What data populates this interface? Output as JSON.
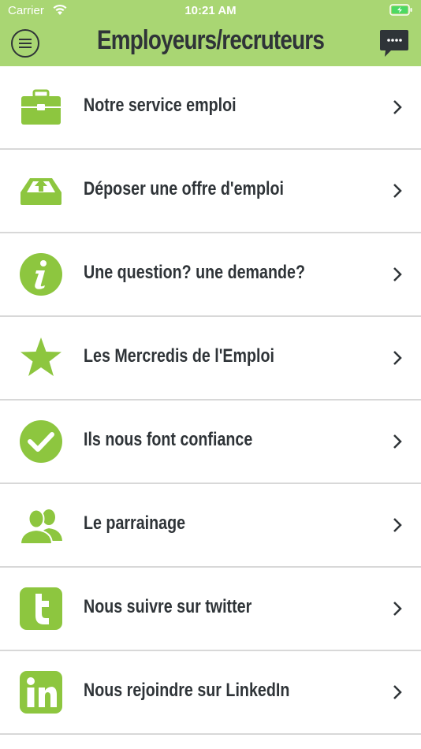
{
  "status_bar": {
    "carrier": "Carrier",
    "time": "10:21 AM"
  },
  "header": {
    "title": "Employeurs/recruteurs",
    "background": "#a9d673"
  },
  "accent_color": "#8dc63f",
  "menu_items": [
    {
      "label": "Notre service emploi",
      "icon": "briefcase-icon"
    },
    {
      "label": "Déposer une offre d'emploi",
      "icon": "upload-tray-icon"
    },
    {
      "label": "Une question? une demande?",
      "icon": "info-icon"
    },
    {
      "label": "Les Mercredis de l'Emploi",
      "icon": "star-icon"
    },
    {
      "label": "Ils nous font confiance",
      "icon": "checkmark-icon"
    },
    {
      "label": "Le parrainage",
      "icon": "users-icon"
    },
    {
      "label": "Nous suivre sur twitter",
      "icon": "twitter-icon"
    },
    {
      "label": "Nous rejoindre sur LinkedIn",
      "icon": "linkedin-icon"
    }
  ]
}
